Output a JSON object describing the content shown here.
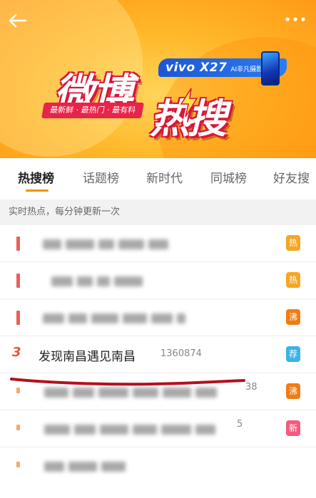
{
  "banner": {
    "tagline": "最新鲜 · 最热门 · 最有料",
    "logo_line1": "微博",
    "logo_line2": "热搜",
    "ad_brand": "vivo X27",
    "ad_slogan": "AI非凡摄影",
    "colors": {
      "bg": "#ffb82a",
      "logo_red": "#d8173a",
      "ad_blue": "#1a57d6"
    }
  },
  "tabs": [
    {
      "label": "热搜榜",
      "active": true
    },
    {
      "label": "话题榜"
    },
    {
      "label": "新时代"
    },
    {
      "label": "同城榜"
    },
    {
      "label": "好友搜"
    }
  ],
  "subheader": "实时热点，每分钟更新一次",
  "featured": {
    "rank": "3",
    "title": "发现南昌遇见南昌",
    "count": "1360874",
    "badge": "荐"
  },
  "badges": {
    "row1": "热",
    "row2": "热",
    "row3": "沸",
    "row5": "沸",
    "row6": "新"
  },
  "trailing": {
    "row5": "38",
    "row6": "5"
  },
  "colors": {
    "hot": "#f5a623",
    "boil": "#f07c16",
    "recommend": "#3ab3e6",
    "new": "#f45a7c",
    "marker_top": "#e8605a",
    "marker_mid": "#f5a96b",
    "accent": "#f29100",
    "annotation": "#b3111e"
  }
}
